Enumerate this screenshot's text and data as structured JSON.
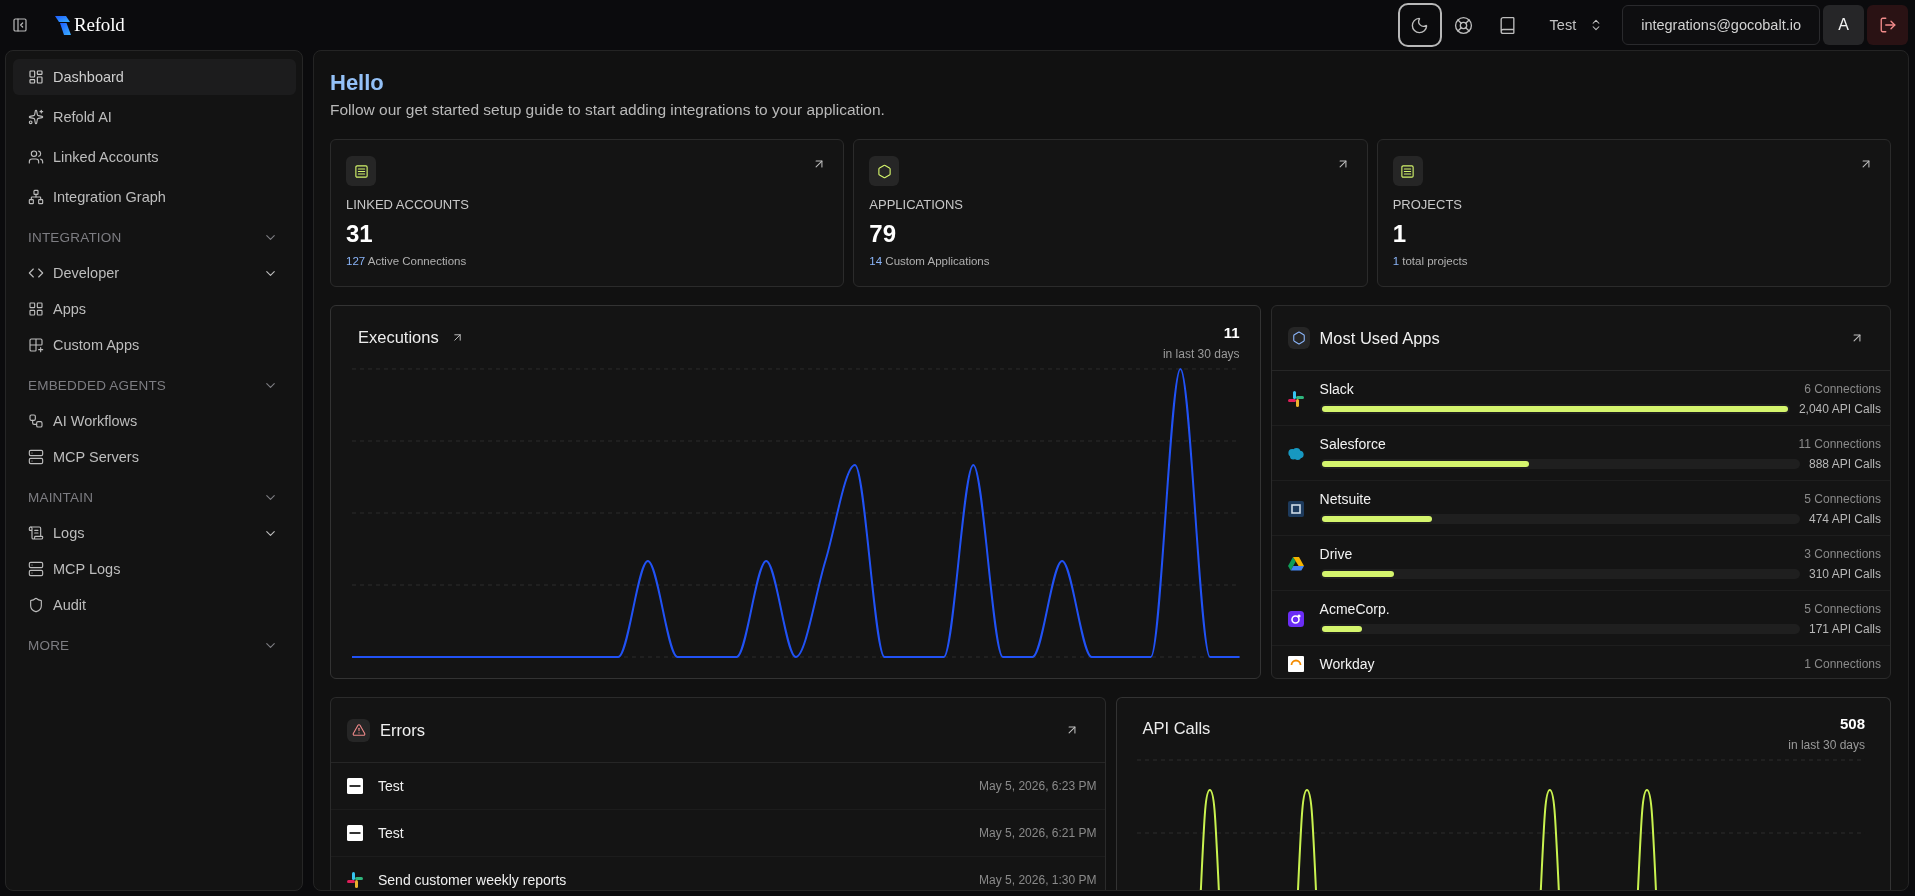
{
  "topbar": {
    "brand": "Refold",
    "tools": [
      {
        "kind": "theme",
        "selected": true
      },
      {
        "kind": "help",
        "selected": false
      },
      {
        "kind": "docs",
        "selected": false
      }
    ],
    "workspace": "Test",
    "email": "integrations@gocobalt.io",
    "avatar": "A"
  },
  "sidebar": {
    "groups": [
      {
        "items": [
          {
            "label": "Dashboard",
            "kind": "link",
            "selected": true
          },
          {
            "label": "Refold AI",
            "kind": "link",
            "selected": false
          },
          {
            "label": "Linked Accounts",
            "kind": "link",
            "selected": false
          },
          {
            "label": "Integration Graph",
            "kind": "link",
            "selected": false
          }
        ]
      },
      {
        "title": "INTEGRATION",
        "items": [
          {
            "label": "Developer",
            "kind": "submenu",
            "selected": false
          },
          {
            "label": "Apps",
            "kind": "link",
            "selected": false
          },
          {
            "label": "Custom Apps",
            "kind": "link",
            "selected": false
          }
        ]
      },
      {
        "title": "EMBEDDED AGENTS",
        "items": [
          {
            "label": "AI Workflows",
            "kind": "link",
            "selected": false
          },
          {
            "label": "MCP Servers",
            "kind": "link",
            "selected": false
          }
        ]
      },
      {
        "title": "MAINTAIN",
        "items": [
          {
            "label": "Logs",
            "kind": "submenu",
            "selected": false
          },
          {
            "label": "MCP Logs",
            "kind": "link",
            "selected": false
          },
          {
            "label": "Audit",
            "kind": "link",
            "selected": false
          }
        ]
      },
      {
        "title": "MORE"
      }
    ]
  },
  "greeting": {
    "title": "Hello",
    "subtitle": "Follow our get started setup guide to start adding integrations to your application."
  },
  "stats": [
    {
      "label": "LINKED ACCOUNTS",
      "value": "31",
      "count": "127",
      "detail": "Active Connections"
    },
    {
      "label": "APPLICATIONS",
      "value": "79",
      "count": "14",
      "detail": "Custom Applications"
    },
    {
      "label": "PROJECTS",
      "value": "1",
      "count": "1",
      "detail": "total projects"
    }
  ],
  "executions": {
    "title": "Executions",
    "total": "11",
    "period": "in last 30 days"
  },
  "most_used_apps": {
    "title": "Most Used Apps",
    "apps": [
      {
        "name": "Slack",
        "connections": "6 Connections",
        "api_calls": "2,040 API Calls",
        "level": 1.0
      },
      {
        "name": "Salesforce",
        "connections": "11 Connections",
        "api_calls": "888 API Calls",
        "level": 0.435
      },
      {
        "name": "Netsuite",
        "connections": "5 Connections",
        "api_calls": "474 API Calls",
        "level": 0.232
      },
      {
        "name": "Drive",
        "connections": "3 Connections",
        "api_calls": "310 API Calls",
        "level": 0.152
      },
      {
        "name": "AcmeCorp.",
        "connections": "5 Connections",
        "api_calls": "171 API Calls",
        "level": 0.084
      },
      {
        "name": "Workday",
        "connections": "1 Connections"
      }
    ]
  },
  "errors": {
    "title": "Errors",
    "rows": [
      {
        "name": "Test",
        "time": "May 5, 2026, 6:23 PM"
      },
      {
        "name": "Test",
        "time": "May 5, 2026, 6:21 PM"
      },
      {
        "name": "Send customer weekly reports",
        "time": "May 5, 2026, 1:30 PM"
      }
    ]
  },
  "api_calls": {
    "title": "API Calls",
    "total": "508",
    "period": "in last 30 days"
  }
}
